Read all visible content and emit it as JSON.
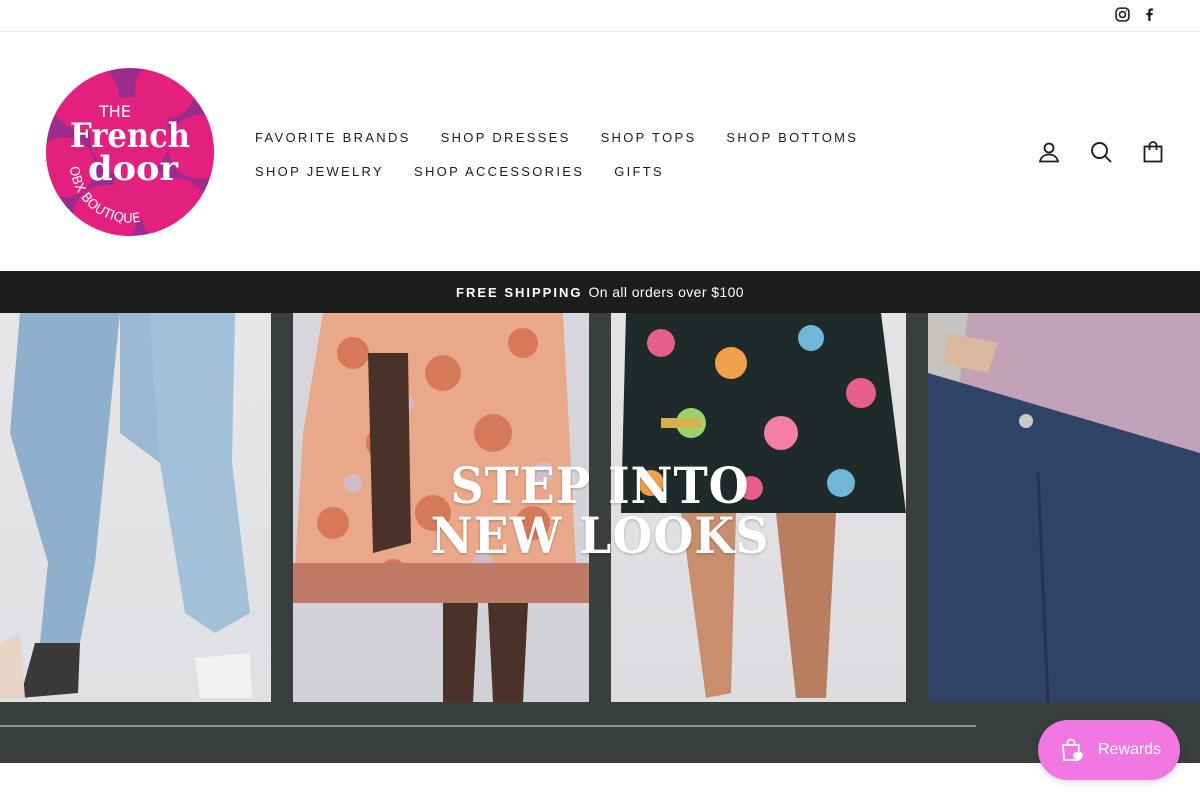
{
  "social": {
    "instagram_icon": "instagram-icon",
    "facebook_icon": "facebook-icon"
  },
  "logo": {
    "line1": "THE",
    "line2": "French",
    "line3": "door",
    "tagline": "OBX BOUTIQUE",
    "color_primary": "#e3207e",
    "color_accent": "#9b2c8e"
  },
  "nav": {
    "row1": [
      "FAVORITE BRANDS",
      "SHOP DRESSES",
      "SHOP TOPS",
      "SHOP BOTTOMS"
    ],
    "row2": [
      "SHOP JEWELRY",
      "SHOP ACCESSORIES",
      "GIFTS"
    ]
  },
  "header_icons": {
    "account": "user-icon",
    "search": "search-icon",
    "cart": "bag-icon"
  },
  "announcement": {
    "bold": "FREE SHIPPING",
    "text": "On all orders over $100",
    "background": "#1c1d1d"
  },
  "hero": {
    "line1": "STEP INTO",
    "line2": "NEW LOOKS",
    "background": "#3a3e3c"
  },
  "rewards": {
    "label": "Rewards",
    "color": "#f178e3",
    "icon": "gift-bag-heart-icon"
  }
}
